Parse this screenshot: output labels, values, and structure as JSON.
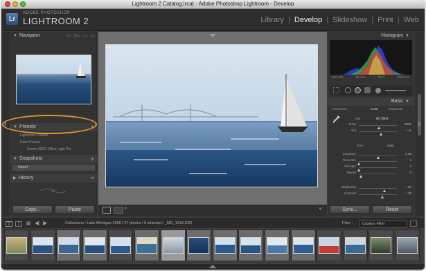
{
  "window": {
    "title": "Lightroom 2 Catalog.lrcat - Adobe Photoshop Lightroom - Develop",
    "colors": {
      "close": "#e0463c",
      "minimize": "#e8b630",
      "zoom": "#5ebd3e",
      "annotation": "#e8932a",
      "accent": "#2f6fc4"
    }
  },
  "identity": {
    "logo": "Lr",
    "vendor": "ADOBE PHOTOSHOP",
    "product": "LIGHTROOM 2"
  },
  "modules": {
    "library": "Library",
    "develop": "Develop",
    "slideshow": "Slideshow",
    "print": "Print",
    "web": "Web",
    "active": "Develop"
  },
  "left": {
    "navigator": {
      "title": "Navigator",
      "options": "FIT FILL 1:1 3:1"
    },
    "presets": {
      "title": "Presets",
      "items": [
        "Lightroom Presets",
        "User Presets",
        "Canon 350D Office Light Pre"
      ]
    },
    "snapshots": {
      "title": "Snapshots",
      "item": "import"
    },
    "history": {
      "title": "History"
    },
    "copy_label": "Copy...",
    "paste_label": "Paste"
  },
  "right": {
    "histogram": {
      "title": "Histogram",
      "info": [
        "ISO 100",
        "55 mm",
        "f/9.0",
        "1/500 sec"
      ]
    },
    "basic": {
      "title": "Basic",
      "treatment_label": "Treatment :",
      "treatment_color": "Color",
      "treatment_gray": "Grayscale",
      "wb_label": "WB :",
      "wb_value": "As Shot",
      "sliders": [
        {
          "label": "Temp",
          "value": "5500",
          "level": 0.52
        },
        {
          "label": "Tint",
          "value": "+ 11",
          "level": 0.58
        },
        {
          "label": "Exposure",
          "value": "0.00",
          "level": 0.5
        },
        {
          "label": "Recovery",
          "value": "0",
          "level": 0.0
        },
        {
          "label": "Fill Light",
          "value": "0",
          "level": 0.0
        },
        {
          "label": "Blacks",
          "value": "5",
          "level": 0.05
        },
        {
          "label": "Brightness",
          "value": "+ 50",
          "level": 0.67
        },
        {
          "label": "Contrast",
          "value": "+ 25",
          "level": 0.62
        }
      ],
      "tone_label": "Tone",
      "auto_label": "Auto"
    },
    "sync_label": "Sync...",
    "reset_label": "Reset"
  },
  "filmstrip": {
    "breadcrumb": "Collections / Lake Michigan 2009 / 27 photos / 9 selected / _MG_1518.CR2",
    "filter_label": "Filter :",
    "filter_value": "Custom Filter",
    "thumbnails": [
      {
        "state": "normal"
      },
      {
        "state": "normal"
      },
      {
        "state": "selected"
      },
      {
        "state": "selected"
      },
      {
        "state": "normal"
      },
      {
        "state": "selected"
      },
      {
        "state": "current"
      },
      {
        "state": "selected"
      },
      {
        "state": "selected"
      },
      {
        "state": "selected"
      },
      {
        "state": "selected"
      },
      {
        "state": "selected"
      },
      {
        "state": "normal"
      },
      {
        "state": "normal"
      },
      {
        "state": "normal"
      },
      {
        "state": "normal"
      }
    ]
  }
}
